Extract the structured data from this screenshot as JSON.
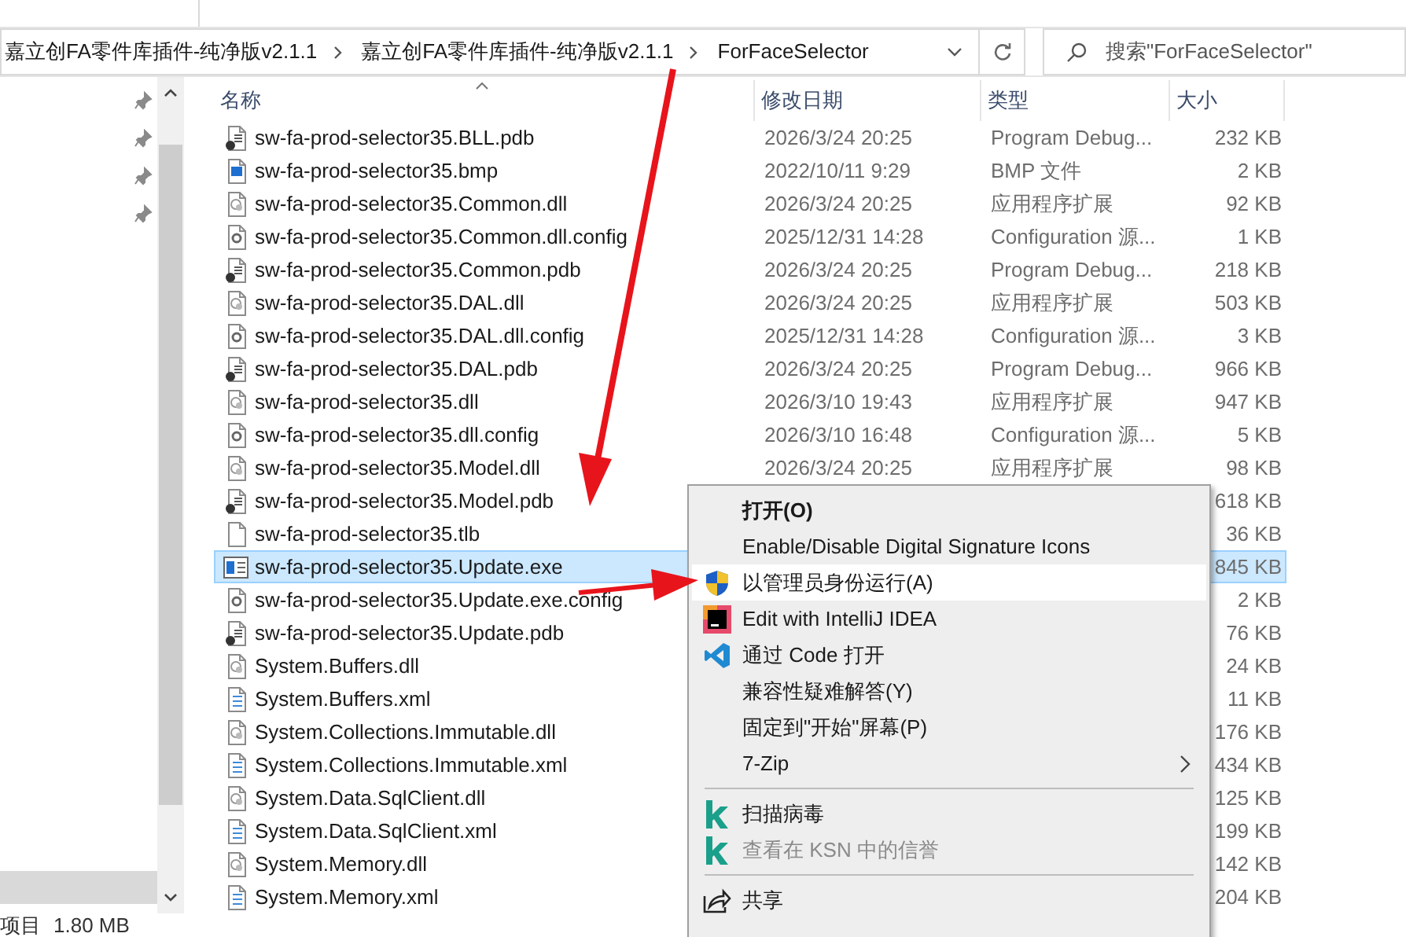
{
  "address_bar": {
    "segments": [
      "嘉立创FA零件库插件-纯净版v2.1.1",
      "嘉立创FA零件库插件-纯净版v2.1.1",
      "ForFaceSelector"
    ],
    "search_placeholder": "搜索\"ForFaceSelector\""
  },
  "columns": [
    "名称",
    "修改日期",
    "类型",
    "大小"
  ],
  "rows": [
    {
      "kind": "pdb",
      "name": "sw-fa-prod-selector35.BLL.pdb",
      "date": "2026/3/24 20:25",
      "type": "Program Debug...",
      "size": "232 KB",
      "selected": false
    },
    {
      "kind": "bmp",
      "name": "sw-fa-prod-selector35.bmp",
      "date": "2022/10/11 9:29",
      "type": "BMP 文件",
      "size": "2 KB",
      "selected": false
    },
    {
      "kind": "dll",
      "name": "sw-fa-prod-selector35.Common.dll",
      "date": "2026/3/24 20:25",
      "type": "应用程序扩展",
      "size": "92 KB",
      "selected": false
    },
    {
      "kind": "config",
      "name": "sw-fa-prod-selector35.Common.dll.config",
      "date": "2025/12/31 14:28",
      "type": "Configuration 源...",
      "size": "1 KB",
      "selected": false
    },
    {
      "kind": "pdb",
      "name": "sw-fa-prod-selector35.Common.pdb",
      "date": "2026/3/24 20:25",
      "type": "Program Debug...",
      "size": "218 KB",
      "selected": false
    },
    {
      "kind": "dll",
      "name": "sw-fa-prod-selector35.DAL.dll",
      "date": "2026/3/24 20:25",
      "type": "应用程序扩展",
      "size": "503 KB",
      "selected": false
    },
    {
      "kind": "config",
      "name": "sw-fa-prod-selector35.DAL.dll.config",
      "date": "2025/12/31 14:28",
      "type": "Configuration 源...",
      "size": "3 KB",
      "selected": false
    },
    {
      "kind": "pdb",
      "name": "sw-fa-prod-selector35.DAL.pdb",
      "date": "2026/3/24 20:25",
      "type": "Program Debug...",
      "size": "966 KB",
      "selected": false
    },
    {
      "kind": "dll",
      "name": "sw-fa-prod-selector35.dll",
      "date": "2026/3/10 19:43",
      "type": "应用程序扩展",
      "size": "947 KB",
      "selected": false
    },
    {
      "kind": "config",
      "name": "sw-fa-prod-selector35.dll.config",
      "date": "2026/3/10 16:48",
      "type": "Configuration 源...",
      "size": "5 KB",
      "selected": false
    },
    {
      "kind": "dll",
      "name": "sw-fa-prod-selector35.Model.dll",
      "date": "2026/3/24 20:25",
      "type": "应用程序扩展",
      "size": "98 KB",
      "selected": false
    },
    {
      "kind": "pdb",
      "name": "sw-fa-prod-selector35.Model.pdb",
      "size": "618 KB",
      "selected": false
    },
    {
      "kind": "blank",
      "name": "sw-fa-prod-selector35.tlb",
      "size": "36 KB",
      "selected": false
    },
    {
      "kind": "exe",
      "name": "sw-fa-prod-selector35.Update.exe",
      "size": "845 KB",
      "selected": true
    },
    {
      "kind": "config",
      "name": "sw-fa-prod-selector35.Update.exe.config",
      "size": "2 KB",
      "selected": false
    },
    {
      "kind": "pdb",
      "name": "sw-fa-prod-selector35.Update.pdb",
      "size": "76 KB",
      "selected": false
    },
    {
      "kind": "dll",
      "name": "System.Buffers.dll",
      "size": "24 KB",
      "selected": false
    },
    {
      "kind": "xml",
      "name": "System.Buffers.xml",
      "size": "11 KB",
      "selected": false
    },
    {
      "kind": "dll",
      "name": "System.Collections.Immutable.dll",
      "size": "176 KB",
      "selected": false
    },
    {
      "kind": "xml",
      "name": "System.Collections.Immutable.xml",
      "size": "434 KB",
      "selected": false
    },
    {
      "kind": "dll",
      "name": "System.Data.SqlClient.dll",
      "size": "125 KB",
      "selected": false
    },
    {
      "kind": "xml",
      "name": "System.Data.SqlClient.xml",
      "size": "199 KB",
      "selected": false
    },
    {
      "kind": "dll",
      "name": "System.Memory.dll",
      "size": "142 KB",
      "selected": false
    },
    {
      "kind": "xml",
      "name": "System.Memory.xml",
      "size": "204 KB",
      "selected": false
    }
  ],
  "context_menu": {
    "items": [
      {
        "kind": "plain",
        "label": "打开(O)",
        "bold": true,
        "selected": false,
        "disabled": false,
        "submenu": false
      },
      {
        "kind": "plain",
        "label": "Enable/Disable Digital Signature Icons",
        "bold": false,
        "selected": false,
        "disabled": false,
        "submenu": false
      },
      {
        "kind": "shield",
        "label": "以管理员身份运行(A)",
        "bold": false,
        "selected": true,
        "disabled": false,
        "submenu": false
      },
      {
        "kind": "ide",
        "label": "Edit with IntelliJ IDEA",
        "bold": false,
        "selected": false,
        "disabled": false,
        "submenu": false
      },
      {
        "kind": "code",
        "label": "通过 Code 打开",
        "bold": false,
        "selected": false,
        "disabled": false,
        "submenu": false
      },
      {
        "kind": "plain",
        "label": "兼容性疑难解答(Y)",
        "bold": false,
        "selected": false,
        "disabled": false,
        "submenu": false
      },
      {
        "kind": "plain",
        "label": "固定到\"开始\"屏幕(P)",
        "bold": false,
        "selected": false,
        "disabled": false,
        "submenu": false
      },
      {
        "kind": "plain",
        "label": "7-Zip",
        "bold": false,
        "selected": false,
        "disabled": false,
        "submenu": true
      },
      {
        "kind": "separator"
      },
      {
        "kind": "scan",
        "label": "扫描病毒",
        "bold": false,
        "selected": false,
        "disabled": false,
        "submenu": false
      },
      {
        "kind": "scan",
        "label": "查看在 KSN 中的信誉",
        "bold": false,
        "selected": false,
        "disabled": true,
        "submenu": false
      },
      {
        "kind": "separator"
      },
      {
        "kind": "share",
        "label": "共享",
        "bold": false,
        "selected": false,
        "disabled": false,
        "submenu": false
      }
    ]
  },
  "status_bar": {
    "count": "项目",
    "size": "1.80 MB"
  }
}
